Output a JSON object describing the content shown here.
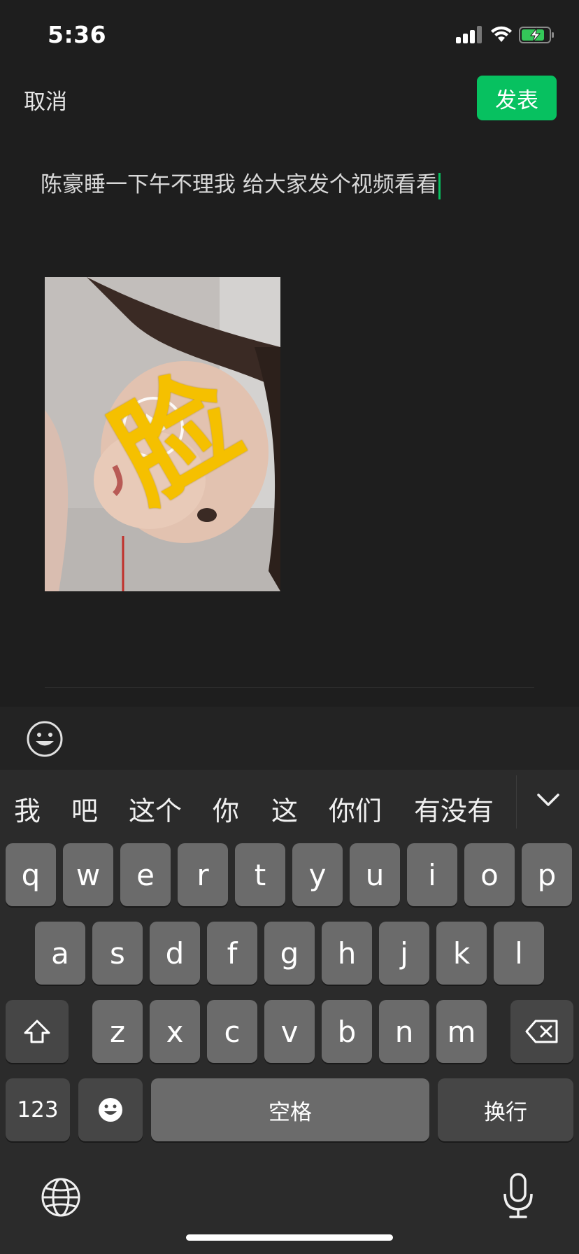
{
  "status_bar": {
    "time": "5:36"
  },
  "header": {
    "cancel_label": "取消",
    "publish_label": "发表"
  },
  "post": {
    "text": "陈豪睡一下午不理我 给大家发个视频看看"
  },
  "thumbnail": {
    "overlay_char": "脸"
  },
  "candidates": [
    "我",
    "吧",
    "这个",
    "你",
    "这",
    "你们",
    "有没有"
  ],
  "keyboard": {
    "row1": [
      "q",
      "w",
      "e",
      "r",
      "t",
      "y",
      "u",
      "i",
      "o",
      "p"
    ],
    "row2": [
      "a",
      "s",
      "d",
      "f",
      "g",
      "h",
      "j",
      "k",
      "l"
    ],
    "row3": [
      "z",
      "x",
      "c",
      "v",
      "b",
      "n",
      "m"
    ],
    "numbers_label": "123",
    "space_label": "空格",
    "return_label": "换行"
  },
  "colors": {
    "accent": "#07c160",
    "background": "#1e1e1e",
    "key": "#6b6b6b",
    "key_dark": "#464646"
  }
}
